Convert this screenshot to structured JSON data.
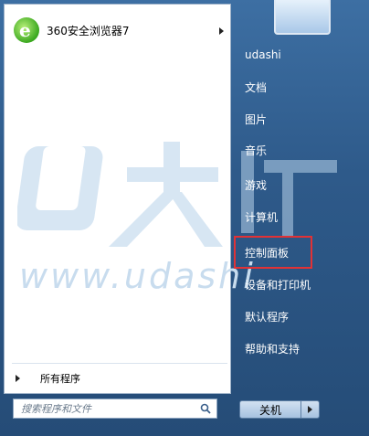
{
  "left": {
    "pinned_app": "360安全浏览器7",
    "watermark_brand": "U大师",
    "watermark_url": "www.udashi",
    "all_programs": "所有程序",
    "search_placeholder": "搜索程序和文件"
  },
  "right": {
    "items": [
      {
        "label": "udashi"
      },
      {
        "label": "文档"
      },
      {
        "label": "图片"
      },
      {
        "label": "音乐"
      },
      {
        "label": "游戏"
      },
      {
        "label": "计算机"
      },
      {
        "label": "控制面板"
      },
      {
        "label": "设备和打印机"
      },
      {
        "label": "默认程序"
      },
      {
        "label": "帮助和支持"
      }
    ],
    "shutdown": "关机"
  },
  "colors": {
    "highlight": "#e13236",
    "watermark": "#b7d2ea"
  }
}
